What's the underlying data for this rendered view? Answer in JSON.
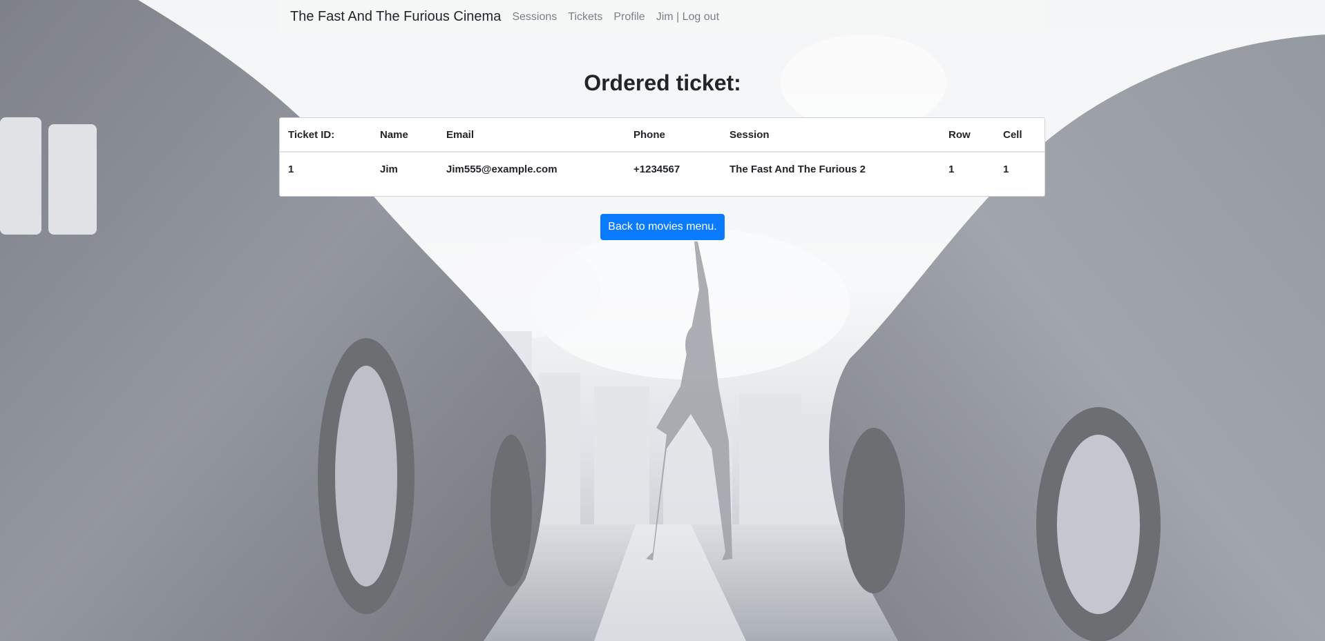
{
  "navbar": {
    "brand": "The Fast And The Furious Cinema",
    "links": [
      "Sessions",
      "Tickets",
      "Profile",
      "Jim | Log out"
    ]
  },
  "page": {
    "title": "Ordered ticket:"
  },
  "ticket_table": {
    "headers": [
      "Ticket ID:",
      "Name",
      "Email",
      "Phone",
      "Session",
      "Row",
      "Cell"
    ],
    "rows": [
      [
        "1",
        "Jim",
        "Jim555@example.com",
        "+1234567",
        "The Fast And The Furious 2",
        "1",
        "1"
      ]
    ]
  },
  "actions": {
    "back_label": "Back to movies menu."
  },
  "colors": {
    "primary": "#0a7bff",
    "nav_text": "#7a7f85",
    "text": "#212529"
  },
  "background": {
    "description_icon": "cars-background-photo"
  }
}
